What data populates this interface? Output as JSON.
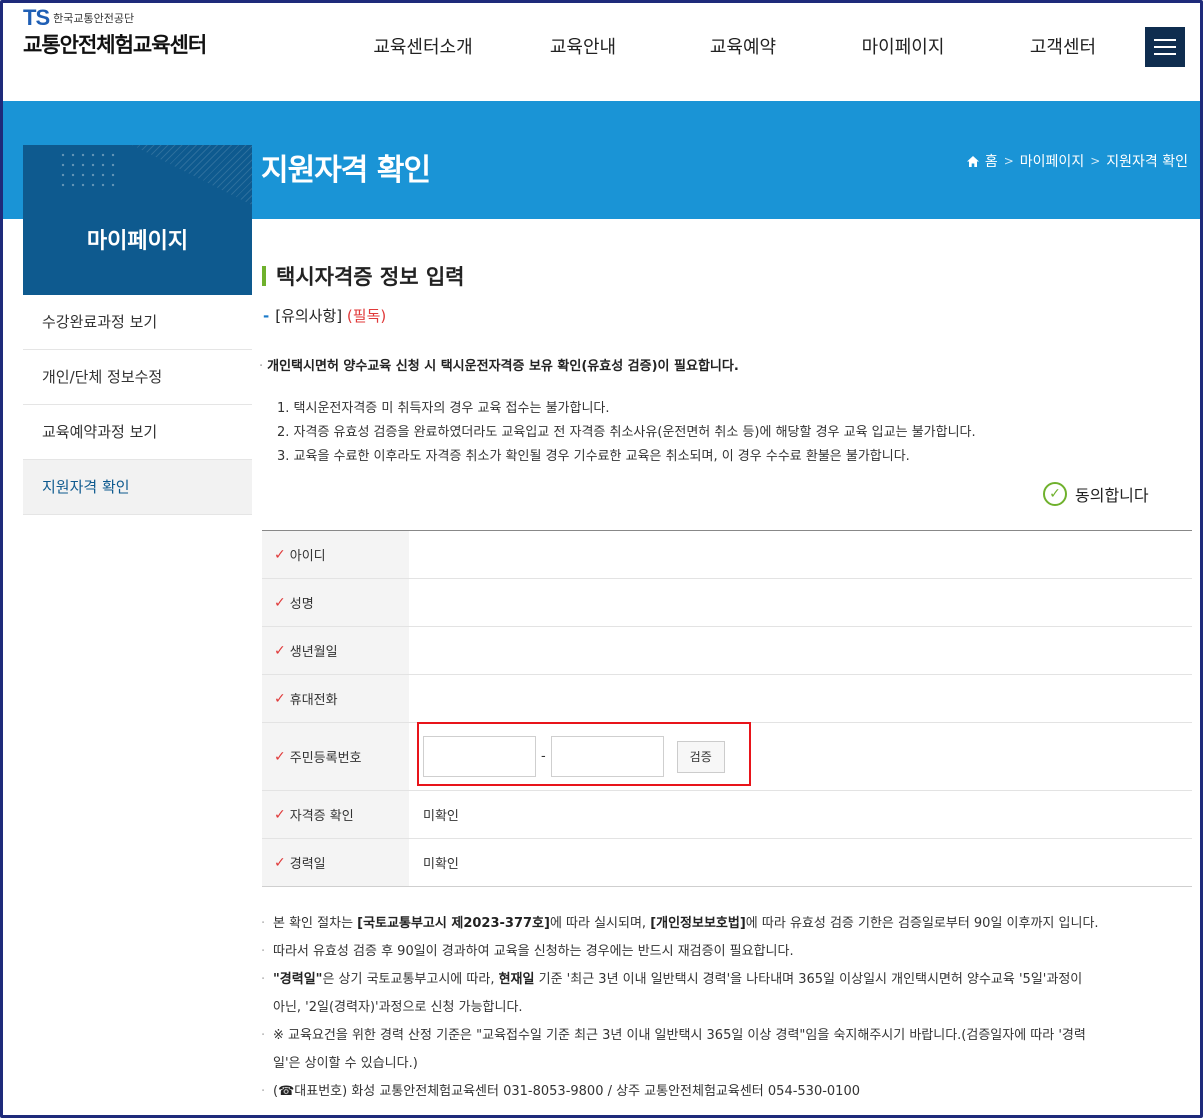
{
  "header": {
    "logo_mark": "TS",
    "logo_org": "한국교통안전공단",
    "site_name": "교통안전체험교육센터",
    "nav": [
      "교육센터소개",
      "교육안내",
      "교육예약",
      "마이페이지",
      "고객센터"
    ]
  },
  "banner": {
    "page_title": "지원자격 확인",
    "breadcrumb": [
      "홈",
      "마이페이지",
      "지원자격 확인"
    ]
  },
  "sidebar": {
    "title": "마이페이지",
    "items": [
      {
        "label": "수강완료과정 보기",
        "active": false
      },
      {
        "label": "개인/단체 정보수정",
        "active": false
      },
      {
        "label": "교육예약과정 보기",
        "active": false
      },
      {
        "label": "지원자격 확인",
        "active": true
      }
    ]
  },
  "section": {
    "title": "택시자격증 정보 입력",
    "notice_label": "[유의사항]",
    "notice_must": "(필독)",
    "lead": "개인택시면허 양수교육 신청 시 택시운전자격증 보유 확인(유효성 검증)이 필요합니다.",
    "rules": [
      "1. 택시운전자격증 미 취득자의 경우 교육 접수는 불가합니다.",
      "2. 자격증 유효성 검증을 완료하였더라도 교육입교 전 자격증 취소사유(운전면허 취소 등)에 해당할 경우 교육 입교는 불가합니다.",
      "3. 교육을 수료한 이후라도 자격증 취소가 확인될 경우 기수료한 교육은 취소되며, 이 경우 수수료 환불은 불가합니다."
    ],
    "agree_label": "동의합니다"
  },
  "form": {
    "fields": {
      "id": {
        "label": "아이디",
        "value": ""
      },
      "name": {
        "label": "성명",
        "value": ""
      },
      "birth": {
        "label": "생년월일",
        "value": ""
      },
      "phone": {
        "label": "휴대전화",
        "value": ""
      },
      "ssn": {
        "label": "주민등록번호",
        "front": "",
        "back": "",
        "separator": "-",
        "button": "검증"
      },
      "license": {
        "label": "자격증 확인",
        "value": "미확인"
      },
      "career": {
        "label": "경력일",
        "value": "미확인"
      }
    }
  },
  "notes": {
    "n1_a": "본 확인 절차는 ",
    "n1_b": "[국토교통부고시 제2023-377호]",
    "n1_c": "에 따라 실시되며, ",
    "n1_d": "[개인정보보호법]",
    "n1_e": "에 따라 유효성 검증 기한은 검증일로부터 90일 이후까지 입니다.",
    "n2": "따라서 유효성 검증 후 90일이 경과하여 교육을 신청하는 경우에는 반드시 재검증이 필요합니다.",
    "n3_a": "\"경력일\"",
    "n3_b": "은 상기 국토교통부고시에 따라, ",
    "n3_c": "현재일",
    "n3_d": " 기준 '최근 3년 이내 일반택시 경력'을 나타내며 365일 이상일시 개인택시면허 양수교육 '5일'과정이",
    "n3_e": "아닌, '2일(경력자)'과정으로 신청 가능합니다.",
    "n4_a": "※ 교육요건을 위한 경력 산정 기준은 \"교육접수일 기준 최근 3년 이내 일반택시 365일 이상 경력\"임을 숙지해주시기 바랍니다.(검증일자에 따라 '경력",
    "n4_b": "일'은 상이할 수 있습니다.)",
    "n5_a": "(",
    "n5_icon": "☎",
    "n5_b": "대표번호) 화성 교통안전체험교육센터 031-8053-9800 / 상주 교통안전체험교육센터 054-530-0100"
  }
}
